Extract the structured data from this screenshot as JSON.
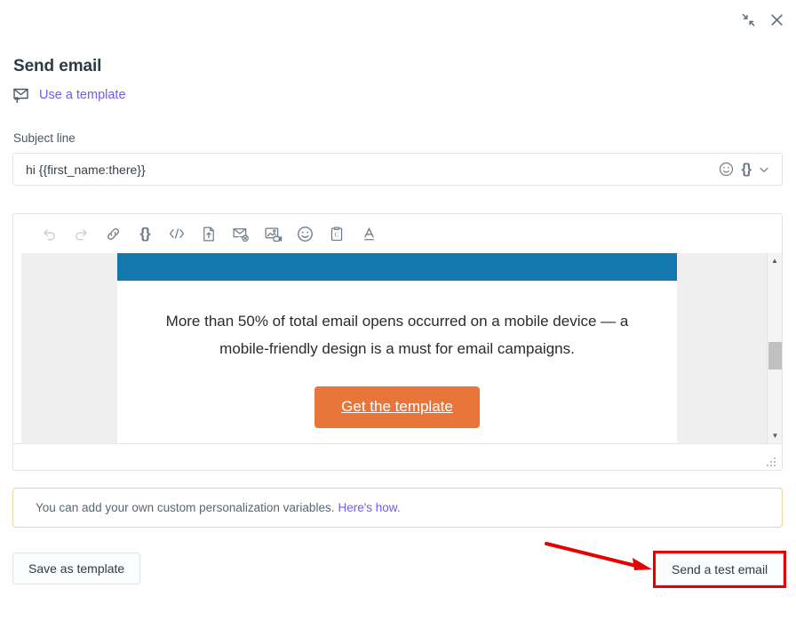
{
  "window": {
    "minimize_icon": "collapse-diagonal-icon",
    "close_icon": "close-icon"
  },
  "header": {
    "title": "Send email",
    "template_link": "Use a template",
    "template_icon": "envelope-upload-icon"
  },
  "subject": {
    "label": "Subject line",
    "value": "hi {{first_name:there}}",
    "placeholder": "Subject line",
    "tools": [
      {
        "name": "emoji-icon",
        "glyph": "emoji"
      },
      {
        "name": "personalization-variable-icon",
        "glyph": "{}"
      },
      {
        "name": "chevron-down-icon",
        "glyph": "chevron"
      }
    ]
  },
  "editor": {
    "toolbar": [
      {
        "name": "undo-icon",
        "label": "Undo",
        "disabled": true
      },
      {
        "name": "redo-icon",
        "label": "Redo",
        "disabled": true
      },
      {
        "name": "link-icon",
        "label": "Insert link",
        "disabled": false
      },
      {
        "name": "personalization-variable-icon",
        "label": "Insert variable",
        "disabled": false
      },
      {
        "name": "code-icon",
        "label": "Source code",
        "disabled": false
      },
      {
        "name": "file-upload-icon",
        "label": "Attach document",
        "disabled": false
      },
      {
        "name": "unsubscribe-email-icon",
        "label": "Unsubscribe link",
        "disabled": false
      },
      {
        "name": "image-video-icon",
        "label": "Insert image or video",
        "disabled": false
      },
      {
        "name": "emoji-icon",
        "label": "Insert emoji",
        "disabled": false
      },
      {
        "name": "meeting-clipboard-icon",
        "label": "Insert meeting link",
        "disabled": false
      },
      {
        "name": "text-color-icon",
        "label": "Text color",
        "disabled": false
      }
    ],
    "body": {
      "paragraph": "More than 50% of total email opens occurred on a mobile device — a mobile-friendly design is a must for email campaigns.",
      "cta_label": "Get the template",
      "hero_color": "#1278ad",
      "cta_color": "#e8763a"
    },
    "scrollbar": {
      "up_arrow": "▲",
      "down_arrow": "▼"
    },
    "resize_handle": "resize-grip-icon"
  },
  "notice": {
    "text": "You can add your own custom personalization variables.",
    "link": "Here's how.",
    "border_color": "#e8d79a",
    "link_color": "#6e5cf4"
  },
  "footer": {
    "save_label": "Save as template",
    "send_test_label": "Send a test email"
  },
  "annotation": {
    "highlight_color": "#e60000",
    "arrow_target": "send-a-test-email-button"
  }
}
